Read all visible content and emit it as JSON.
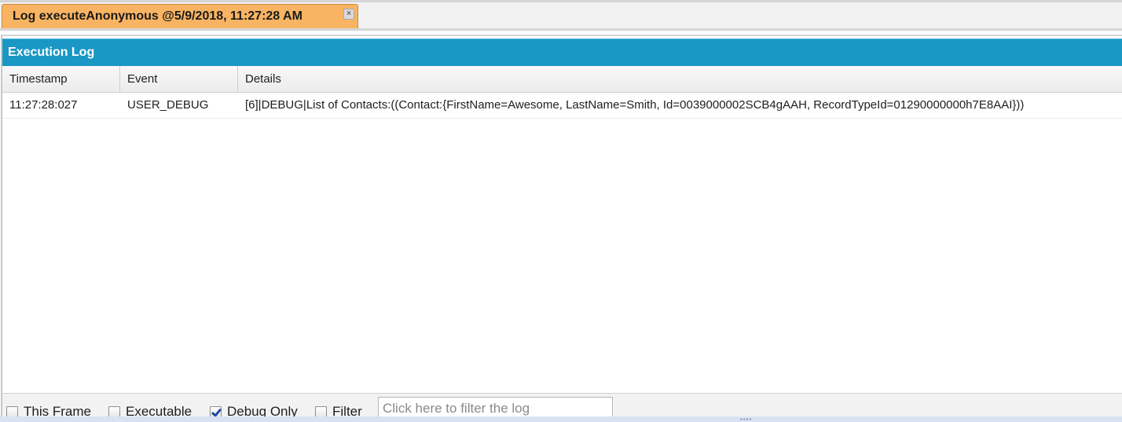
{
  "tab": {
    "title": "Log executeAnonymous @5/9/2018, 11:27:28 AM",
    "close_icon": "close-icon"
  },
  "panel": {
    "title": "Execution Log"
  },
  "grid": {
    "columns": [
      "Timestamp",
      "Event",
      "Details"
    ],
    "rows": [
      {
        "timestamp": "11:27:28:027",
        "event": "USER_DEBUG",
        "details": "[6]|DEBUG|List of Contacts:((Contact:{FirstName=Awesome, LastName=Smith, Id=0039000002SCB4gAAH, RecordTypeId=01290000000h7E8AAI}))"
      }
    ]
  },
  "toolbar": {
    "this_frame": {
      "label": "This Frame",
      "checked": false
    },
    "executable": {
      "label": "Executable",
      "checked": false
    },
    "debug_only": {
      "label": "Debug Only",
      "checked": true
    },
    "filter": {
      "label": "Filter",
      "checked": false
    },
    "filter_placeholder": "Click here to filter the log"
  },
  "colors": {
    "tab_active": "#f9b463",
    "panel_header": "#1a97c4",
    "checkbox_check": "#1d4fa3"
  }
}
